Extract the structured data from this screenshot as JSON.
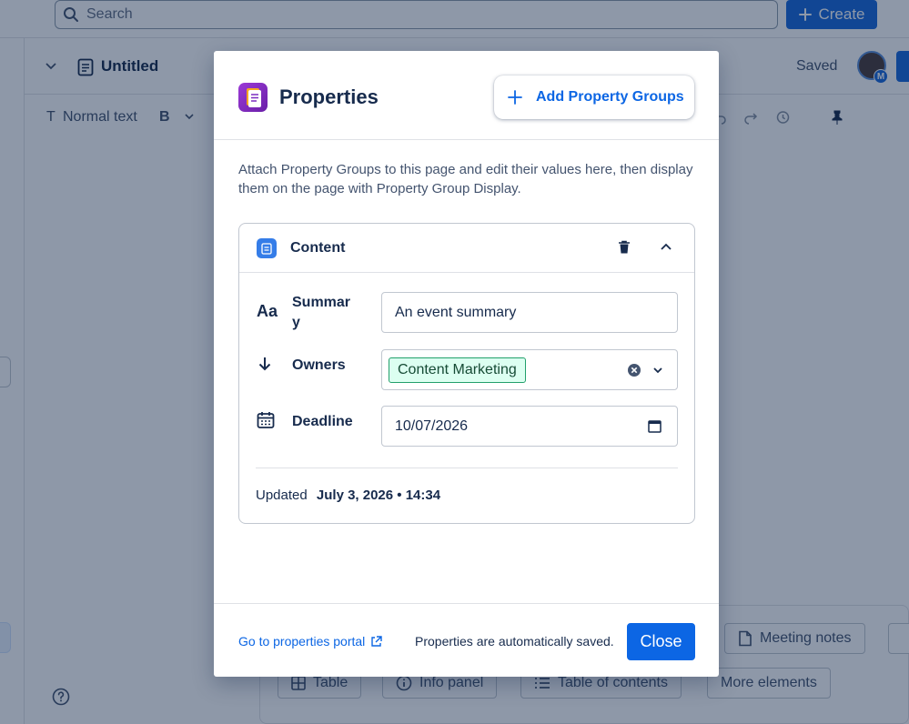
{
  "topbar": {
    "search_placeholder": "Search",
    "create_label": "Create"
  },
  "page": {
    "title": "Untitled",
    "saved_label": "Saved",
    "avatar_badge": "M"
  },
  "toolbar": {
    "text_style_glyph": "T",
    "text_style": "Normal text",
    "bold_label": "B"
  },
  "bottom_panel": {
    "buttons": [
      "Meeting notes",
      "Table",
      "Info panel",
      "Table of contents",
      "More elements"
    ]
  },
  "modal": {
    "title": "Properties",
    "add_groups_label": "Add Property Groups",
    "description": "Attach Property Groups to this page and edit their values here, then display them on the page with Property Group Display.",
    "group": {
      "name": "Content",
      "properties": [
        {
          "icon_glyph": "Aa",
          "label": "Summary",
          "value": "An event summary"
        },
        {
          "label": "Owners",
          "tag": "Content Marketing"
        },
        {
          "label": "Deadline",
          "value": "10/07/2026"
        }
      ],
      "updated_label": "Updated",
      "updated_value": "July 3, 2026 • 14:34"
    },
    "footer": {
      "portal_link": "Go to properties portal",
      "autosave_note": "Properties are automatically saved.",
      "close_label": "Close"
    }
  },
  "colors": {
    "primary": "#0c66e4",
    "tag_border": "#22a06b",
    "tag_bg": "#dcfff1",
    "logo": "#7b2bbf"
  }
}
